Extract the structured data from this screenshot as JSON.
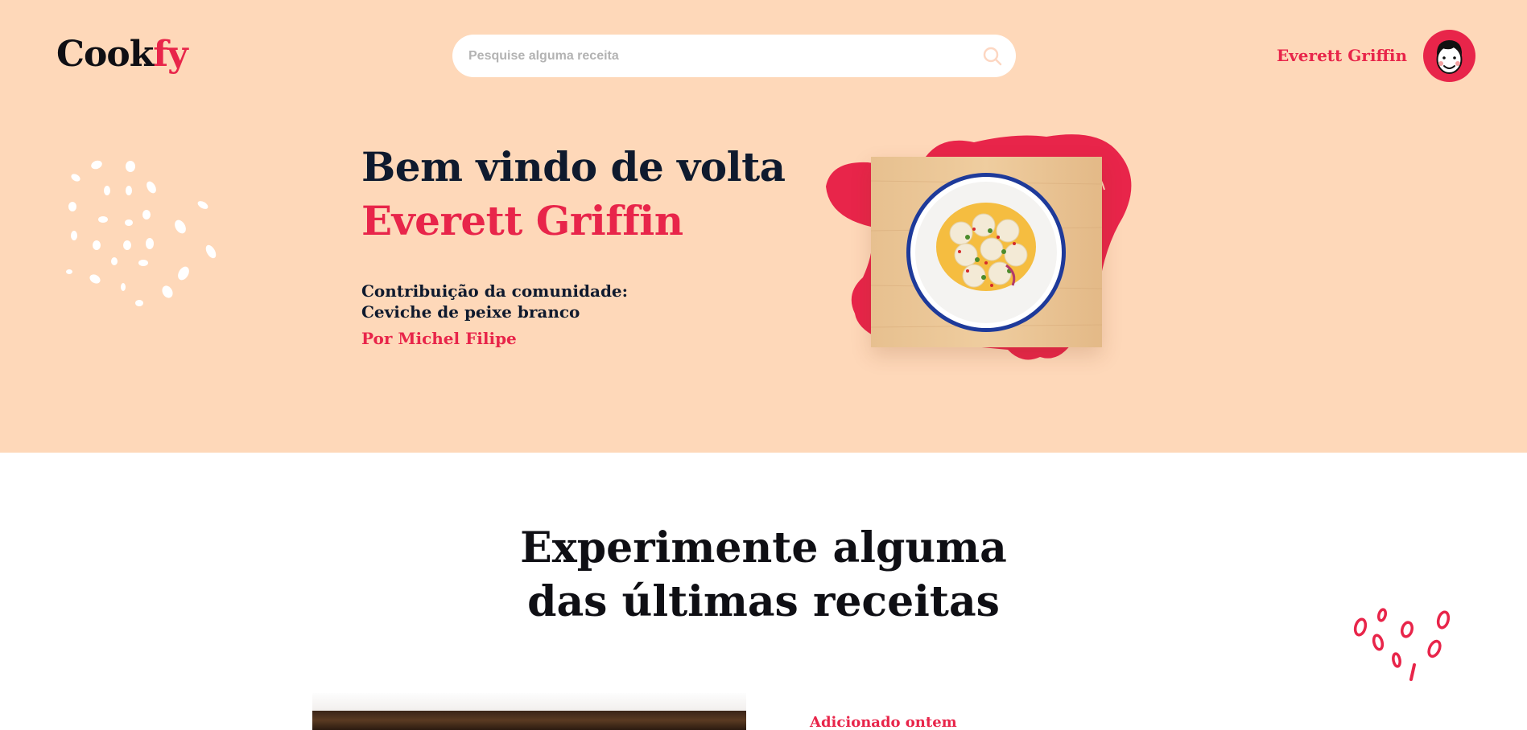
{
  "header": {
    "logo_main": "Cook",
    "logo_accent": "fy",
    "search_placeholder": "Pesquise alguma receita",
    "search_icon": "search-icon",
    "user_name": "Everett Griffin",
    "avatar_icon": "avatar-face-icon"
  },
  "hero": {
    "welcome": "Bem vindo de volta",
    "user_name": "Everett Griffin",
    "community_label": "Contribuição da comunidade:",
    "community_recipe": "Ceviche de peixe branco",
    "community_author": "Por Michel Filipe"
  },
  "latest": {
    "title_line1": "Experimente alguma",
    "title_line2": "das últimas receitas",
    "card_added": "Adicionado ontem"
  },
  "colors": {
    "hero_bg": "#fed8b9",
    "accent": "#e8254a",
    "text_dark": "#0f1a2e"
  }
}
